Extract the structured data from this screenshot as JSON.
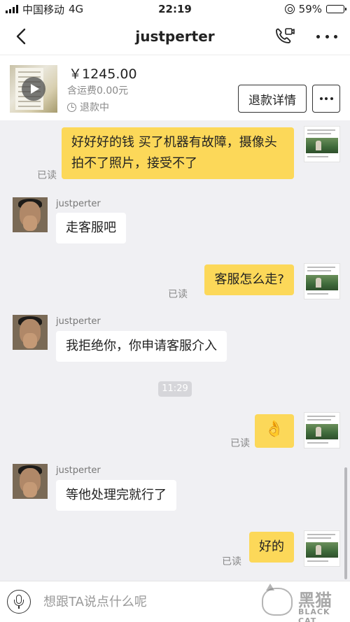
{
  "status_bar": {
    "carrier": "中国移动",
    "network": "4G",
    "time": "22:19",
    "battery_text": "59%",
    "battery_level": 0.59
  },
  "nav": {
    "title": "justperter",
    "icons": {
      "back": "chevron-left-icon",
      "call": "video-call-icon",
      "more": "more-dots-icon"
    }
  },
  "order": {
    "price": "￥1245.00",
    "shipping": "含运费0.00元",
    "status": "退款中",
    "refund_button": "退款详情"
  },
  "messages": [
    {
      "from": "me",
      "text": "好好好的钱  买了机器有故障，摄像头拍不了照片，接受不了",
      "read": "已读"
    },
    {
      "from": "other",
      "sender": "justperter",
      "text": "走客服吧"
    },
    {
      "from": "me",
      "text": "客服怎么走?",
      "read": "已读"
    },
    {
      "from": "other",
      "sender": "justperter",
      "text": "我拒绝你，你申请客服介入"
    },
    {
      "type": "time",
      "text": "11:29"
    },
    {
      "from": "me",
      "text": "👌",
      "read": "已读"
    },
    {
      "from": "other",
      "sender": "justperter",
      "text": "等他处理完就行了"
    },
    {
      "from": "me",
      "text": "好的",
      "read": "已读"
    }
  ],
  "input": {
    "placeholder": "想跟TA说点什么呢"
  },
  "watermark": {
    "text": "黑猫",
    "sub": "BLACK CAT"
  },
  "colors": {
    "my_bubble": "#fcd859",
    "their_bubble": "#ffffff",
    "chat_background": "#f0f0f3"
  }
}
